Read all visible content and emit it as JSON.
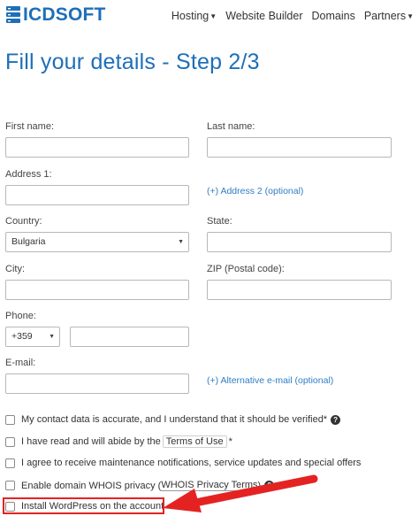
{
  "header": {
    "logo_text": "ICDSOFT",
    "nav": [
      {
        "label": "Hosting",
        "dropdown": true
      },
      {
        "label": "Website Builder",
        "dropdown": false
      },
      {
        "label": "Domains",
        "dropdown": false
      },
      {
        "label": "Partners",
        "dropdown": true
      }
    ]
  },
  "page": {
    "title": "Fill your details - Step 2/3"
  },
  "form": {
    "first_name_label": "First name:",
    "last_name_label": "Last name:",
    "address1_label": "Address 1:",
    "address2_link": "(+) Address 2 (optional)",
    "country_label": "Country:",
    "country_value": "Bulgaria",
    "state_label": "State:",
    "city_label": "City:",
    "zip_label": "ZIP (Postal code):",
    "phone_label": "Phone:",
    "phone_code": "+359",
    "email_label": "E-mail:",
    "alt_email_link": "(+) Alternative e-mail (optional)"
  },
  "checkboxes": {
    "contact_accurate": "My contact data is accurate, and I understand that it should be verified*",
    "terms_prefix": "I have read and will abide by the",
    "terms_link": "Terms of Use",
    "terms_suffix": "*",
    "maintenance": "I agree to receive maintenance notifications, service updates and special offers",
    "whois_prefix": "Enable domain WHOIS privacy (",
    "whois_link": "WHOIS Privacy Terms",
    "whois_suffix": ")",
    "wordpress": "Install WordPress on the account"
  },
  "colors": {
    "brand": "#1e6fb8",
    "link": "#2f7dc4",
    "annotation": "#e52222"
  },
  "icons": {
    "logo": "server-stack-icon",
    "help": "question-circle-icon",
    "annotation": "red-arrow-icon"
  }
}
